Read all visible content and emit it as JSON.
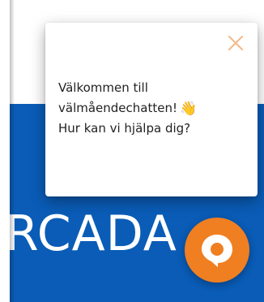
{
  "popup": {
    "line1": "Välkommen till",
    "line2": "välmåendechatten!",
    "wave_emoji": "👋",
    "line3": "Hur kan vi hjälpa dig?"
  },
  "background": {
    "brand_text": "RCADA"
  },
  "colors": {
    "brand_blue": "#0a5cb7",
    "accent_orange": "#f07f21",
    "close_icon": "#f3b98a"
  },
  "icons": {
    "close": "close-icon",
    "launcher": "chat-bubble-icon"
  }
}
